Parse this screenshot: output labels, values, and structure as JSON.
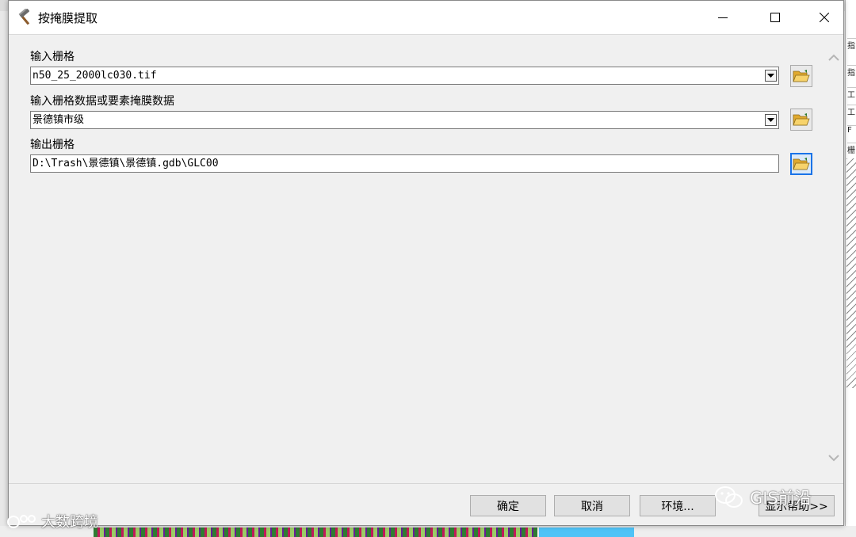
{
  "window": {
    "title": "按掩膜提取",
    "icon": "hammer-icon"
  },
  "params": [
    {
      "label": "输入栅格",
      "value": "n50_25_2000lc030.tif",
      "type": "combo"
    },
    {
      "label": "输入栅格数据或要素掩膜数据",
      "value": "景德镇市级",
      "type": "combo"
    },
    {
      "label": "输出栅格",
      "value": "D:\\Trash\\景德镇\\景德镇.gdb\\GLC00",
      "type": "text"
    }
  ],
  "buttons": {
    "ok": "确定",
    "cancel": "取消",
    "environments": "环境...",
    "show_help": "显示帮助>>"
  },
  "background_fragments": [
    "指",
    "工",
    "工",
    "F",
    "栅"
  ],
  "watermarks": {
    "left": "大数跨境",
    "right": "GIS前沿"
  },
  "colors": {
    "accent": "#1a73e8",
    "folder": "#f2c14e"
  }
}
